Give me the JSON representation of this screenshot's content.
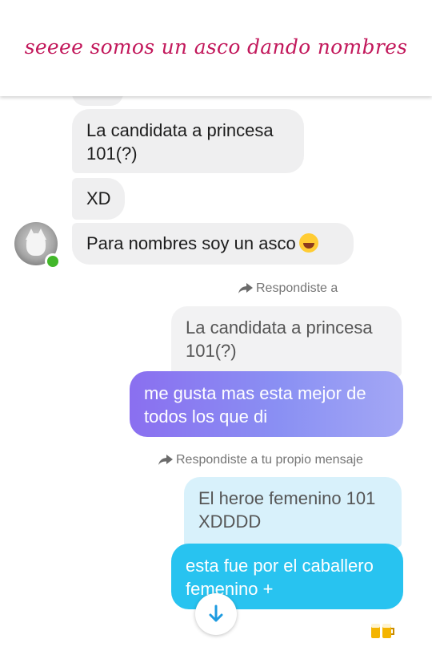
{
  "caption": "seeee somos un asco dando nombres",
  "messages": {
    "incoming": [
      {
        "text": "La candidata a princesa 101(?)"
      },
      {
        "text": "XD"
      },
      {
        "text": "Para nombres soy un asco",
        "emoji": "rolling-on-floor-laughing-emoji"
      }
    ],
    "reply_label_1": "Respondiste a",
    "quoted_1": "La candidata a princesa 101(?)",
    "outgoing_1": "me gusta mas esta mejor de todos los que di",
    "reply_label_2": "Respondiste a tu propio mensaje",
    "quoted_2": "El heroe femenino 101 XDDDD",
    "outgoing_2": "esta fue por el caballero femenino +"
  },
  "icons": {
    "reply": "reply-arrow-icon",
    "scroll_down": "arrow-down-icon",
    "reaction": "beer-mugs-icon"
  },
  "colors": {
    "caption": "#c2185b",
    "incoming_bubble": "#efeff0",
    "outgoing_purple": "#8a6ff0",
    "outgoing_cyan": "#28c3f0",
    "online": "#42b72a"
  }
}
